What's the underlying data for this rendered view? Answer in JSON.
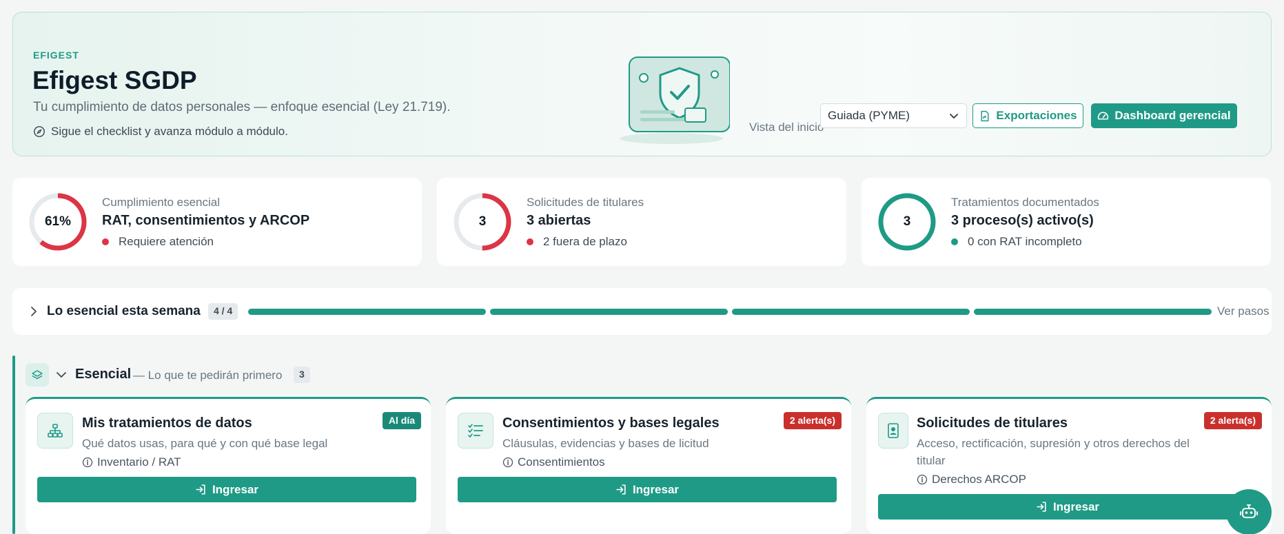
{
  "header": {
    "brand": "EFIGEST",
    "title": "Efigest SGDP",
    "subtitle": "Tu cumplimiento de datos personales — enfoque esencial (Ley 21.719).",
    "hint": "Sigue el checklist y avanza módulo a módulo.",
    "view_label": "Vista del inicio",
    "view_selected": "Guiada (PYME)",
    "export_label": "Exportaciones",
    "dashboard_label": "Dashboard gerencial"
  },
  "stats": [
    {
      "ring_text": "61%",
      "label": "Cumplimiento esencial",
      "value": "RAT, consentimientos y ARCOP",
      "status": "Requiere atención",
      "progress": 0.61,
      "color": "#dc3545"
    },
    {
      "ring_text": "3",
      "label": "Solicitudes de titulares",
      "value": "3 abiertas",
      "status": "2 fuera de plazo",
      "progress": 0.5,
      "color": "#dc3545"
    },
    {
      "ring_text": "3",
      "label": "Tratamientos documentados",
      "value": "3 proceso(s) activo(s)",
      "status": "0 con RAT incompleto",
      "progress": 1.0,
      "color": "#1f9a86"
    }
  ],
  "weekly": {
    "title": "Lo esencial esta semana",
    "badge": "4 / 4",
    "completed_steps": 4,
    "total_steps": 4,
    "link": "Ver pasos"
  },
  "section": {
    "title": "Esencial",
    "subtitle": "— Lo que te pedirán primero",
    "count": "3"
  },
  "cards": [
    {
      "title": "Mis tratamientos de datos",
      "desc": "Qué datos usas, para qué y con qué base legal",
      "tag": "Inventario / RAT",
      "badge": "Al día",
      "badge_color": "#1a8a78",
      "button": "Ingresar",
      "icon": "sitemap-icon"
    },
    {
      "title": "Consentimientos y bases legales",
      "desc": "Cláusulas, evidencias y bases de licitud",
      "tag": "Consentimientos",
      "badge": "2 alerta(s)",
      "badge_color": "#c9302c",
      "button": "Ingresar",
      "icon": "checklist-icon"
    },
    {
      "title": "Solicitudes de titulares",
      "desc": "Acceso, rectificación, supresión y otros derechos del titular",
      "tag": "Derechos ARCOP",
      "badge": "2 alerta(s)",
      "badge_color": "#c9302c",
      "button": "Ingresar",
      "icon": "id-badge-icon"
    }
  ],
  "colors": {
    "accent": "#1f9a86",
    "danger": "#dc3545"
  }
}
